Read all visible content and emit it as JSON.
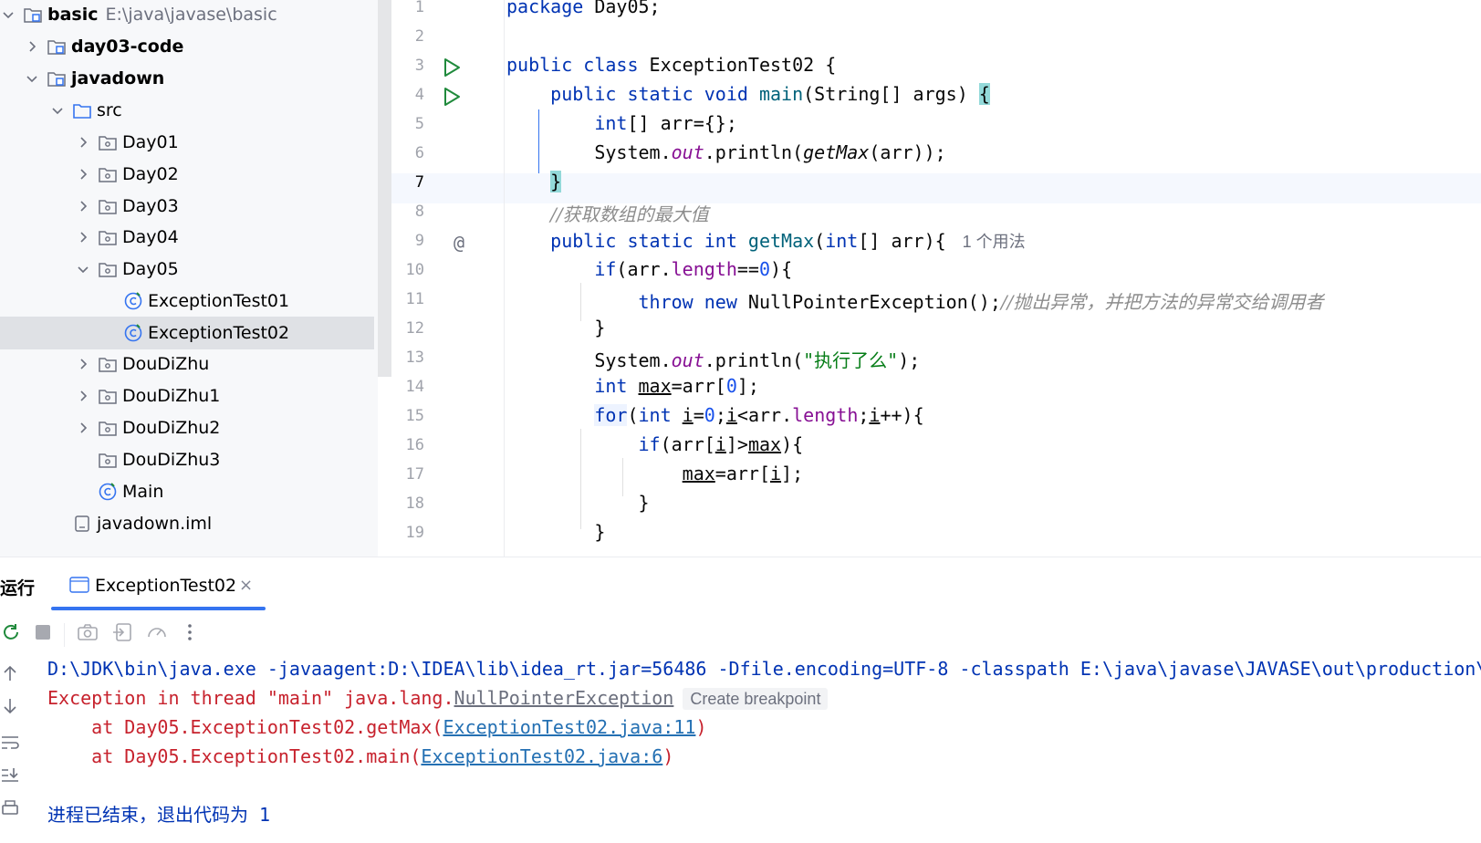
{
  "project_tree": {
    "items": [
      {
        "label": "basic",
        "path": "E:\\java\\javase\\basic"
      },
      {
        "label": "day03-code"
      },
      {
        "label": "javadown"
      },
      {
        "label": "src"
      },
      {
        "label": "Day01"
      },
      {
        "label": "Day02"
      },
      {
        "label": "Day03"
      },
      {
        "label": "Day04"
      },
      {
        "label": "Day05"
      },
      {
        "label": "ExceptionTest01"
      },
      {
        "label": "ExceptionTest02"
      },
      {
        "label": "DouDiZhu"
      },
      {
        "label": "DouDiZhu1"
      },
      {
        "label": "DouDiZhu2"
      },
      {
        "label": "DouDiZhu3"
      },
      {
        "label": "Main"
      },
      {
        "label": "javadown.iml"
      }
    ]
  },
  "editor": {
    "line_numbers": [
      "1",
      "2",
      "3",
      "4",
      "5",
      "6",
      "7",
      "8",
      "9",
      "10",
      "11",
      "12",
      "13",
      "14",
      "15",
      "16",
      "17",
      "18",
      "19"
    ],
    "usage_hint": "1 个用法",
    "comment_line8": "//获取数组的最大值",
    "comment_line11": "//抛出异常，并把方法的异常交给调用者",
    "string_line13": "\"执行了么\""
  },
  "run_panel": {
    "title": "运行",
    "tab_label": "ExceptionTest02",
    "close_glyph": "×",
    "console": {
      "command": "D:\\JDK\\bin\\java.exe -javaagent:D:\\IDEA\\lib\\idea_rt.jar=56486 -Dfile.encoding=UTF-8 -classpath E:\\java\\javase\\JAVASE\\out\\production\\",
      "exception_prefix": "Exception in thread \"main\" java.lang.",
      "exception_class": "NullPointerException",
      "create_breakpoint": "Create breakpoint",
      "trace1_prefix": "    at Day05.ExceptionTest02.getMax(",
      "trace1_link": "ExceptionTest02.java:11",
      "trace1_suffix": ")",
      "trace2_prefix": "    at Day05.ExceptionTest02.main(",
      "trace2_link": "ExceptionTest02.java:6",
      "trace2_suffix": ")",
      "exit_text": "进程已结束，退出代码为",
      "exit_code": "1"
    }
  },
  "colors": {
    "keyword": "#0033b3",
    "number": "#1750eb",
    "string": "#067d17",
    "field": "#871094",
    "comment": "#8c8c8c",
    "error": "#c7222d",
    "link": "#2470b3",
    "run_icon": "#208a3c",
    "accent": "#3574f0"
  }
}
